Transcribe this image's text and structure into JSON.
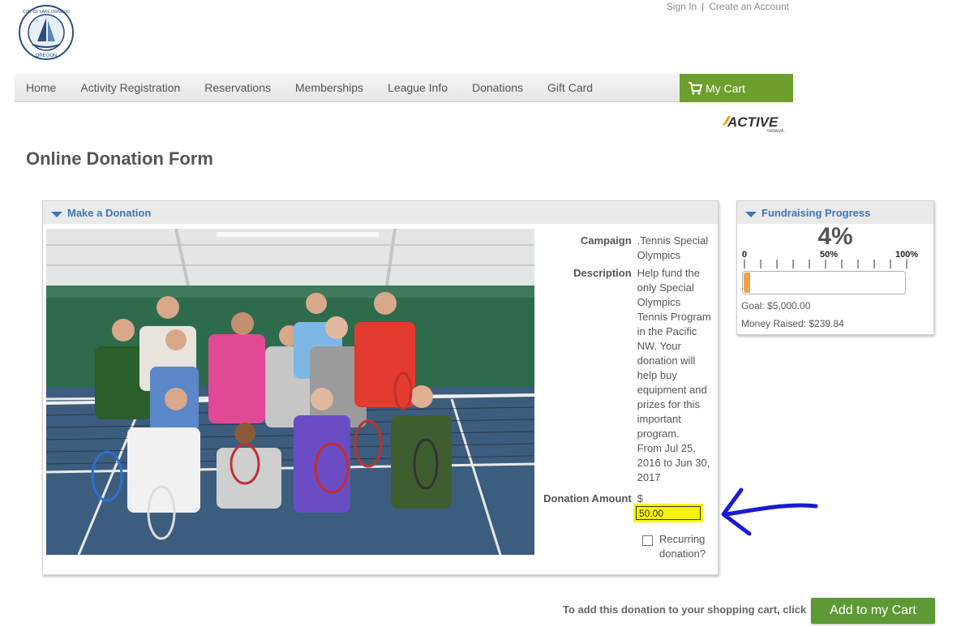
{
  "header": {
    "logo_alt": "City of Lake Oswego Oregon",
    "logo_top_text": "CITY OF LAKE OSWEGO",
    "logo_bottom_text": "OREGON",
    "sign_in": "Sign In",
    "separator": "|",
    "create_account": "Create an Account"
  },
  "nav": {
    "items": [
      "Home",
      "Activity Registration",
      "Reservations",
      "Memberships",
      "League Info",
      "Donations",
      "Gift Card"
    ],
    "cart_label": "My Cart"
  },
  "brand": {
    "name": "ACTIVE",
    "sub": "network."
  },
  "page_title": "Online Donation Form",
  "donation_panel": {
    "header": "Make a Donation",
    "campaign_label": "Campaign",
    "campaign_value": ".Tennis Special Olympics",
    "description_label": "Description",
    "description_value": "Help fund the only Special Olympics Tennis Program in the Pacific NW. Your donation will help buy equipment and prizes for this important program.",
    "date_range": "From Jul 25, 2016 to Jun 30, 2017",
    "amount_label": "Donation Amount",
    "currency": "$",
    "amount_value": "50.00",
    "recurring_label": "Recurring donation?"
  },
  "progress_panel": {
    "header": "Fundraising Progress",
    "percent": "4%",
    "percent_value": 0.04,
    "scale_start": "0",
    "scale_mid": "50%",
    "scale_end": "100%",
    "goal": "Goal: $5,000.00",
    "raised": "Money Raised: $239.84"
  },
  "footer": {
    "instruction": "To add this donation to your shopping cart, click",
    "button": "Add to my Cart"
  },
  "colors": {
    "nav_cart_bg": "#6e9f2d",
    "accent_blue": "#3c76b8",
    "button_green": "#5d9935",
    "highlight": "#f5f500",
    "annotation_arrow": "#1a1ad6"
  }
}
